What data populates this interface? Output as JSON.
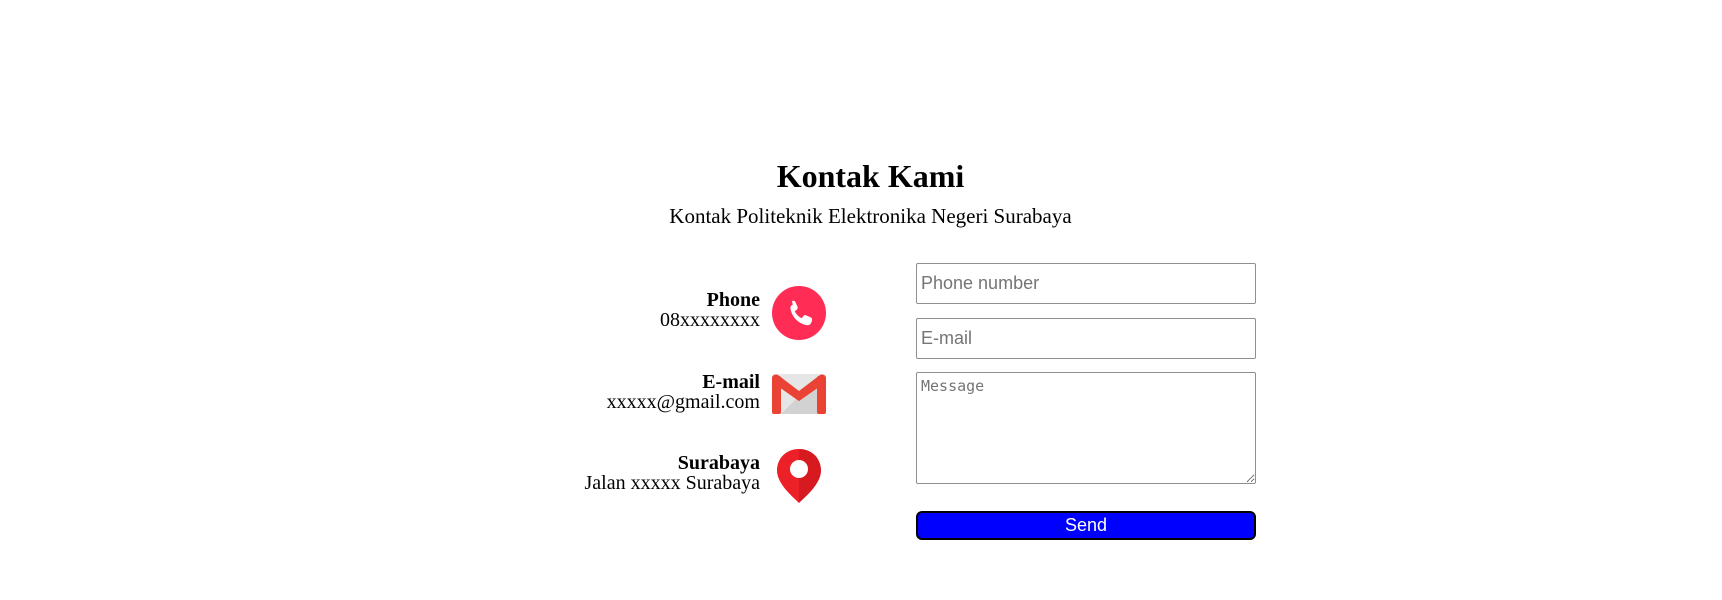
{
  "header": {
    "title": "Kontak Kami",
    "subtitle": "Kontak Politeknik Elektronika Negeri Surabaya"
  },
  "contact_info": [
    {
      "title": "Phone",
      "value": "08xxxxxxxx",
      "icon": "phone-icon",
      "icon_color": "#ff2d55"
    },
    {
      "title": "E-mail",
      "value": "xxxxx@gmail.com",
      "icon": "gmail-icon",
      "icon_color": "#ea4335"
    },
    {
      "title": "Surabaya",
      "value": "Jalan xxxxx Surabaya",
      "icon": "location-pin-icon",
      "icon_color": "#ec2027"
    }
  ],
  "form": {
    "phone_placeholder": "Phone number",
    "phone_value": "",
    "email_placeholder": "E-mail",
    "email_value": "",
    "message_placeholder": "Message",
    "message_value": "",
    "send_label": "Send",
    "send_color": "#0000ff"
  }
}
